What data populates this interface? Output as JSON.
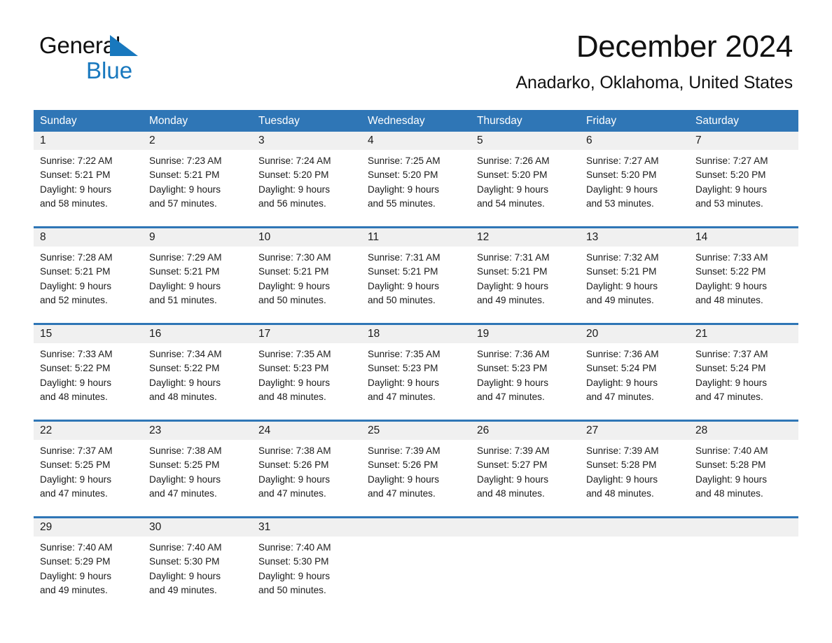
{
  "logo": {
    "word1": "General",
    "word2": "Blue",
    "triangle_color": "#1878be"
  },
  "header": {
    "title": "December 2024",
    "location": "Anadarko, Oklahoma, United States"
  },
  "theme": {
    "header_blue": "#2f76b6",
    "daynum_band": "#f0f0f0",
    "text": "#1a1a1a",
    "white": "#ffffff"
  },
  "weekdays": [
    "Sunday",
    "Monday",
    "Tuesday",
    "Wednesday",
    "Thursday",
    "Friday",
    "Saturday"
  ],
  "weeks": [
    {
      "days": [
        {
          "num": "1",
          "sunrise": "Sunrise: 7:22 AM",
          "sunset": "Sunset: 5:21 PM",
          "daylight1": "Daylight: 9 hours",
          "daylight2": "and 58 minutes."
        },
        {
          "num": "2",
          "sunrise": "Sunrise: 7:23 AM",
          "sunset": "Sunset: 5:21 PM",
          "daylight1": "Daylight: 9 hours",
          "daylight2": "and 57 minutes."
        },
        {
          "num": "3",
          "sunrise": "Sunrise: 7:24 AM",
          "sunset": "Sunset: 5:20 PM",
          "daylight1": "Daylight: 9 hours",
          "daylight2": "and 56 minutes."
        },
        {
          "num": "4",
          "sunrise": "Sunrise: 7:25 AM",
          "sunset": "Sunset: 5:20 PM",
          "daylight1": "Daylight: 9 hours",
          "daylight2": "and 55 minutes."
        },
        {
          "num": "5",
          "sunrise": "Sunrise: 7:26 AM",
          "sunset": "Sunset: 5:20 PM",
          "daylight1": "Daylight: 9 hours",
          "daylight2": "and 54 minutes."
        },
        {
          "num": "6",
          "sunrise": "Sunrise: 7:27 AM",
          "sunset": "Sunset: 5:20 PM",
          "daylight1": "Daylight: 9 hours",
          "daylight2": "and 53 minutes."
        },
        {
          "num": "7",
          "sunrise": "Sunrise: 7:27 AM",
          "sunset": "Sunset: 5:20 PM",
          "daylight1": "Daylight: 9 hours",
          "daylight2": "and 53 minutes."
        }
      ]
    },
    {
      "days": [
        {
          "num": "8",
          "sunrise": "Sunrise: 7:28 AM",
          "sunset": "Sunset: 5:21 PM",
          "daylight1": "Daylight: 9 hours",
          "daylight2": "and 52 minutes."
        },
        {
          "num": "9",
          "sunrise": "Sunrise: 7:29 AM",
          "sunset": "Sunset: 5:21 PM",
          "daylight1": "Daylight: 9 hours",
          "daylight2": "and 51 minutes."
        },
        {
          "num": "10",
          "sunrise": "Sunrise: 7:30 AM",
          "sunset": "Sunset: 5:21 PM",
          "daylight1": "Daylight: 9 hours",
          "daylight2": "and 50 minutes."
        },
        {
          "num": "11",
          "sunrise": "Sunrise: 7:31 AM",
          "sunset": "Sunset: 5:21 PM",
          "daylight1": "Daylight: 9 hours",
          "daylight2": "and 50 minutes."
        },
        {
          "num": "12",
          "sunrise": "Sunrise: 7:31 AM",
          "sunset": "Sunset: 5:21 PM",
          "daylight1": "Daylight: 9 hours",
          "daylight2": "and 49 minutes."
        },
        {
          "num": "13",
          "sunrise": "Sunrise: 7:32 AM",
          "sunset": "Sunset: 5:21 PM",
          "daylight1": "Daylight: 9 hours",
          "daylight2": "and 49 minutes."
        },
        {
          "num": "14",
          "sunrise": "Sunrise: 7:33 AM",
          "sunset": "Sunset: 5:22 PM",
          "daylight1": "Daylight: 9 hours",
          "daylight2": "and 48 minutes."
        }
      ]
    },
    {
      "days": [
        {
          "num": "15",
          "sunrise": "Sunrise: 7:33 AM",
          "sunset": "Sunset: 5:22 PM",
          "daylight1": "Daylight: 9 hours",
          "daylight2": "and 48 minutes."
        },
        {
          "num": "16",
          "sunrise": "Sunrise: 7:34 AM",
          "sunset": "Sunset: 5:22 PM",
          "daylight1": "Daylight: 9 hours",
          "daylight2": "and 48 minutes."
        },
        {
          "num": "17",
          "sunrise": "Sunrise: 7:35 AM",
          "sunset": "Sunset: 5:23 PM",
          "daylight1": "Daylight: 9 hours",
          "daylight2": "and 48 minutes."
        },
        {
          "num": "18",
          "sunrise": "Sunrise: 7:35 AM",
          "sunset": "Sunset: 5:23 PM",
          "daylight1": "Daylight: 9 hours",
          "daylight2": "and 47 minutes."
        },
        {
          "num": "19",
          "sunrise": "Sunrise: 7:36 AM",
          "sunset": "Sunset: 5:23 PM",
          "daylight1": "Daylight: 9 hours",
          "daylight2": "and 47 minutes."
        },
        {
          "num": "20",
          "sunrise": "Sunrise: 7:36 AM",
          "sunset": "Sunset: 5:24 PM",
          "daylight1": "Daylight: 9 hours",
          "daylight2": "and 47 minutes."
        },
        {
          "num": "21",
          "sunrise": "Sunrise: 7:37 AM",
          "sunset": "Sunset: 5:24 PM",
          "daylight1": "Daylight: 9 hours",
          "daylight2": "and 47 minutes."
        }
      ]
    },
    {
      "days": [
        {
          "num": "22",
          "sunrise": "Sunrise: 7:37 AM",
          "sunset": "Sunset: 5:25 PM",
          "daylight1": "Daylight: 9 hours",
          "daylight2": "and 47 minutes."
        },
        {
          "num": "23",
          "sunrise": "Sunrise: 7:38 AM",
          "sunset": "Sunset: 5:25 PM",
          "daylight1": "Daylight: 9 hours",
          "daylight2": "and 47 minutes."
        },
        {
          "num": "24",
          "sunrise": "Sunrise: 7:38 AM",
          "sunset": "Sunset: 5:26 PM",
          "daylight1": "Daylight: 9 hours",
          "daylight2": "and 47 minutes."
        },
        {
          "num": "25",
          "sunrise": "Sunrise: 7:39 AM",
          "sunset": "Sunset: 5:26 PM",
          "daylight1": "Daylight: 9 hours",
          "daylight2": "and 47 minutes."
        },
        {
          "num": "26",
          "sunrise": "Sunrise: 7:39 AM",
          "sunset": "Sunset: 5:27 PM",
          "daylight1": "Daylight: 9 hours",
          "daylight2": "and 48 minutes."
        },
        {
          "num": "27",
          "sunrise": "Sunrise: 7:39 AM",
          "sunset": "Sunset: 5:28 PM",
          "daylight1": "Daylight: 9 hours",
          "daylight2": "and 48 minutes."
        },
        {
          "num": "28",
          "sunrise": "Sunrise: 7:40 AM",
          "sunset": "Sunset: 5:28 PM",
          "daylight1": "Daylight: 9 hours",
          "daylight2": "and 48 minutes."
        }
      ]
    },
    {
      "days": [
        {
          "num": "29",
          "sunrise": "Sunrise: 7:40 AM",
          "sunset": "Sunset: 5:29 PM",
          "daylight1": "Daylight: 9 hours",
          "daylight2": "and 49 minutes."
        },
        {
          "num": "30",
          "sunrise": "Sunrise: 7:40 AM",
          "sunset": "Sunset: 5:30 PM",
          "daylight1": "Daylight: 9 hours",
          "daylight2": "and 49 minutes."
        },
        {
          "num": "31",
          "sunrise": "Sunrise: 7:40 AM",
          "sunset": "Sunset: 5:30 PM",
          "daylight1": "Daylight: 9 hours",
          "daylight2": "and 50 minutes."
        },
        {
          "num": "",
          "sunrise": "",
          "sunset": "",
          "daylight1": "",
          "daylight2": ""
        },
        {
          "num": "",
          "sunrise": "",
          "sunset": "",
          "daylight1": "",
          "daylight2": ""
        },
        {
          "num": "",
          "sunrise": "",
          "sunset": "",
          "daylight1": "",
          "daylight2": ""
        },
        {
          "num": "",
          "sunrise": "",
          "sunset": "",
          "daylight1": "",
          "daylight2": ""
        }
      ]
    }
  ]
}
